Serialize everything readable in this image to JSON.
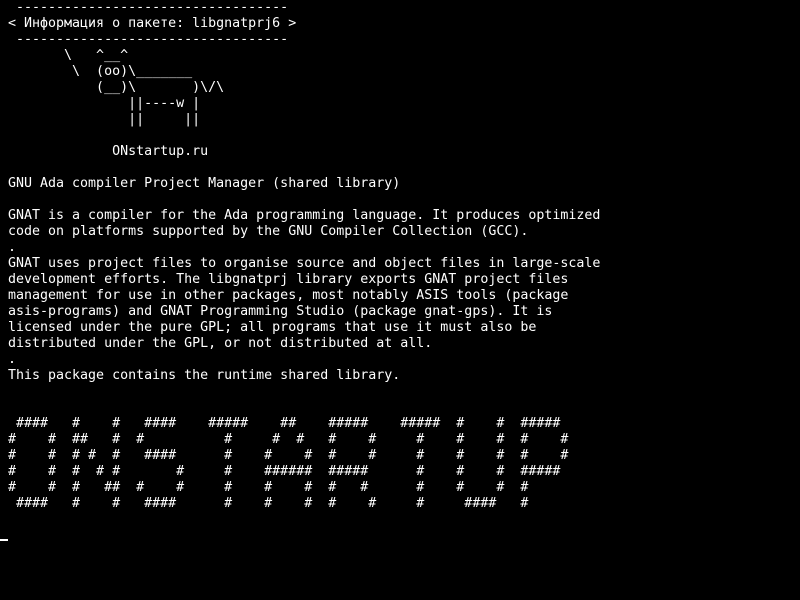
{
  "colors": {
    "background": "#000000",
    "foreground": "#ffffff"
  },
  "terminal": {
    "lines": [
      " ----------------------------------",
      "< Информация о пакете: libgnatprj6 >",
      " ----------------------------------",
      "       \\   ^__^",
      "        \\  (oo)\\_______",
      "           (__)\\       )\\/\\",
      "               ||----w |",
      "               ||     ||",
      "",
      "             ONstartup.ru",
      "",
      "GNU Ada compiler Project Manager (shared library)",
      "",
      "GNAT is a compiler for the Ada programming language. It produces optimized",
      "code on platforms supported by the GNU Compiler Collection (GCC).",
      ".",
      "GNAT uses project files to organise source and object files in large-scale",
      "development efforts. The libgnatprj library exports GNAT project files",
      "management for use in other packages, most notably ASIS tools (package",
      "asis-programs) and GNAT Programming Studio (package gnat-gps). It is",
      "licensed under the pure GPL; all programs that use it must also be",
      "distributed under the GPL, or not distributed at all.",
      ".",
      "This package contains the runtime shared library.",
      "",
      "",
      " ####   #    #   ####    #####    ##    #####    #####  #    #  #####",
      "#    #  ##   #  #          #     #  #   #    #     #    #    #  #    #",
      "#    #  # #  #   ####      #    #    #  #    #     #    #    #  #    #",
      "#    #  #  # #       #     #    ######  #####      #    #    #  #####",
      "#    #  #   ##  #    #     #    #    #  #   #      #    #    #  #",
      " ####   #    #   ####      #    #    #  #    #     #     ####   #"
    ]
  }
}
